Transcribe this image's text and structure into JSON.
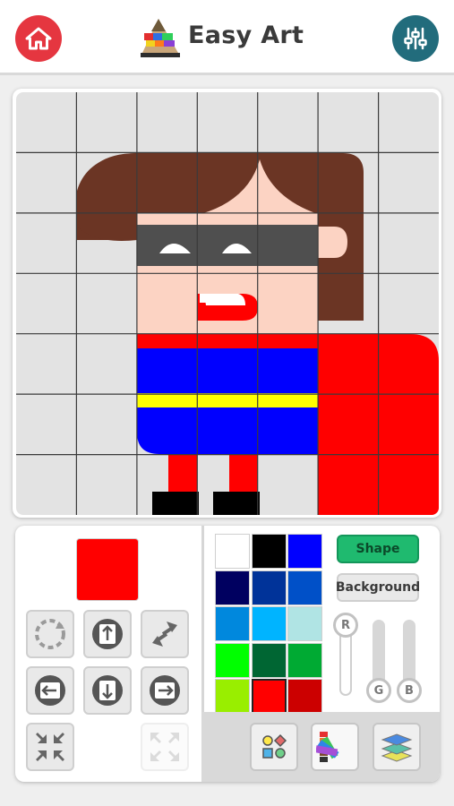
{
  "header": {
    "title": "Easy Art",
    "home_icon": "home-icon",
    "settings_icon": "sliders-icon"
  },
  "canvas": {
    "grid_size": 7,
    "colors": {
      "background": "#e3e3e3",
      "grid_line": "#333333",
      "hair": "#6b3524",
      "skin": "#fcd3c3",
      "mask": "#4f4f4f",
      "mouth": "#ff0000",
      "suit_red": "#ff0000",
      "suit_blue": "#0000ff",
      "belt": "#ffff00",
      "shoes": "#000000",
      "cape": "#ff0000"
    }
  },
  "panel": {
    "preview_color": "#ff0000",
    "tools": [
      {
        "name": "rotate-button",
        "icon": "rotate-icon"
      },
      {
        "name": "move-up-button",
        "icon": "arrow-up-icon"
      },
      {
        "name": "flip-button",
        "icon": "swap-arrows-icon"
      },
      {
        "name": "move-left-button",
        "icon": "arrow-left-icon"
      },
      {
        "name": "move-down-button",
        "icon": "arrow-down-icon"
      },
      {
        "name": "move-right-button",
        "icon": "arrow-right-icon"
      },
      {
        "name": "shrink-button",
        "icon": "shrink-icon"
      },
      {
        "name": "expand-button",
        "icon": "expand-icon"
      }
    ],
    "palette": [
      "#ffffff",
      "#000000",
      "#0000ff",
      "#000060",
      "#003399",
      "#0050c8",
      "#0088dd",
      "#00b4ff",
      "#b0e4e4",
      "#00ff00",
      "#006633",
      "#00aa33",
      "#99ee00",
      "#ff0000",
      "#cc0000"
    ],
    "selected_color": "#ff0000",
    "mode_shape_label": "Shape",
    "mode_background_label": "Background",
    "sliders": {
      "r_label": "R",
      "g_label": "G",
      "b_label": "B"
    },
    "bottom_icons": [
      "shapes-icon",
      "palette-icon",
      "layers-icon"
    ]
  }
}
